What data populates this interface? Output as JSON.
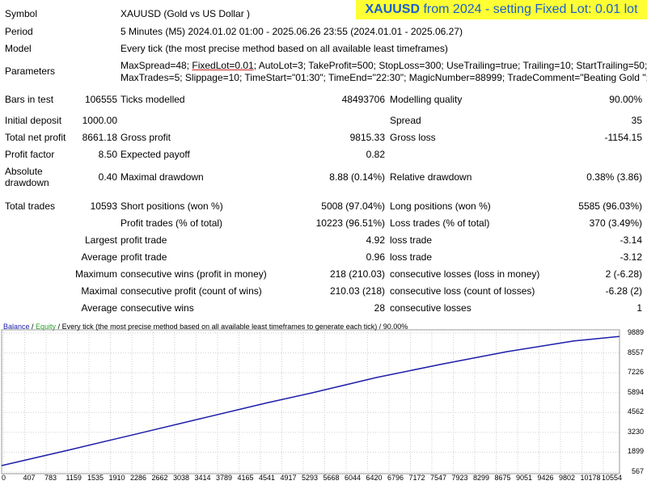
{
  "banner": {
    "ticker": "XAUUSD",
    "rest": "from 2024 - setting Fixed Lot: 0.01 lot"
  },
  "info": {
    "symbol_label": "Symbol",
    "symbol": "XAUUSD (Gold vs US Dollar )",
    "period_label": "Period",
    "period": "5 Minutes (M5) 2024.01.02 01:00 - 2025.06.26 23:55 (2024.01.01 - 2025.06.27)",
    "model_label": "Model",
    "model": "Every tick (the most precise method based on all available least timeframes)",
    "params_label": "Parameters",
    "params_line1_a": "MaxSpread=48; ",
    "params_line1_b": "FixedLot=0.01",
    "params_line1_c": "; AutoLot=3; TakeProfit=500; StopLoss=300; UseTrailing=true; Trailing=10; StartTrailing=50;",
    "params_line2": "MaxTrades=5; Slippage=10; TimeStart=\"01:30\"; TimeEnd=\"22:30\"; MagicNumber=88999; TradeComment=\"Beating Gold \";"
  },
  "stats": {
    "bars_label": "Bars in test",
    "bars": "106555",
    "ticks_label": "Ticks modelled",
    "ticks": "48493706",
    "quality_label": "Modelling quality",
    "quality": "90.00%",
    "deposit_label": "Initial deposit",
    "deposit": "1000.00",
    "spread_label": "Spread",
    "spread": "35",
    "net_label": "Total net profit",
    "net": "8661.18",
    "gross_profit_label": "Gross profit",
    "gross_profit": "9815.33",
    "gross_loss_label": "Gross loss",
    "gross_loss": "-1154.15",
    "pf_label": "Profit factor",
    "pf": "8.50",
    "ep_label": "Expected payoff",
    "ep": "0.82",
    "abs_dd_label_1": "Absolute",
    "abs_dd_label_2": "drawdown",
    "abs_dd": "0.40",
    "max_dd_label": "Maximal drawdown",
    "max_dd": "8.88 (0.14%)",
    "rel_dd_label": "Relative drawdown",
    "rel_dd": "0.38% (3.86)",
    "trades_label": "Total trades",
    "trades": "10593",
    "short_label": "Short positions (won %)",
    "short": "5008 (97.04%)",
    "long_label": "Long positions (won %)",
    "long": "5585 (96.03%)",
    "pt_label": "Profit trades (% of total)",
    "pt": "10223 (96.51%)",
    "lt_label": "Loss trades (% of total)",
    "lt": "370 (3.49%)",
    "largest_label": "Largest",
    "lpt_label": "profit trade",
    "lpt": "4.92",
    "llt_label": "loss trade",
    "llt": "-3.14",
    "average_label": "Average",
    "apt_label": "profit trade",
    "apt": "0.96",
    "alt_label": "loss trade",
    "alt": "-3.12",
    "maximum_label": "Maximum",
    "mcw_label": "consecutive wins (profit in money)",
    "mcw": "218 (210.03)",
    "mcl_label": "consecutive losses (loss in money)",
    "mcl": "2 (-6.28)",
    "maximal_label": "Maximal",
    "mcp_label": "consecutive profit (count of wins)",
    "mcp": "210.03 (218)",
    "mclc_label": "consecutive loss (count of losses)",
    "mclc": "-6.28 (2)",
    "average2_label": "Average",
    "acw_label": "consecutive wins",
    "acw": "28",
    "acl_label": "consecutive losses",
    "acl": "1"
  },
  "chart_data": {
    "type": "line",
    "legend_balance": "Balance",
    "legend_sep": " / ",
    "legend_equity": "Equity",
    "legend_rest": " / Every tick (the most precise method based on all available least timeframes to generate each tick) / 90.00%",
    "y_ticks": [
      "9889",
      "8557",
      "7226",
      "5894",
      "4562",
      "3230",
      "1899",
      "567"
    ],
    "x_ticks": [
      "0",
      "407",
      "783",
      "1159",
      "1535",
      "1910",
      "2286",
      "2662",
      "3038",
      "3414",
      "3789",
      "4165",
      "4541",
      "4917",
      "5293",
      "5668",
      "6044",
      "6420",
      "6796",
      "7172",
      "7547",
      "7923",
      "8299",
      "8675",
      "9051",
      "9426",
      "9802",
      "10178",
      "10554"
    ],
    "ylim": [
      567,
      9889
    ],
    "xlim": [
      0,
      10593
    ],
    "series": [
      {
        "name": "Balance",
        "color": "#1d1daa",
        "x": [
          0,
          1159,
          2286,
          3414,
          4541,
          5293,
          6420,
          7547,
          8675,
          9802,
          10593
        ],
        "y": [
          1000,
          2050,
          3100,
          4150,
          5200,
          5850,
          6900,
          7800,
          8650,
          9350,
          9661
        ]
      }
    ],
    "grid": true
  }
}
